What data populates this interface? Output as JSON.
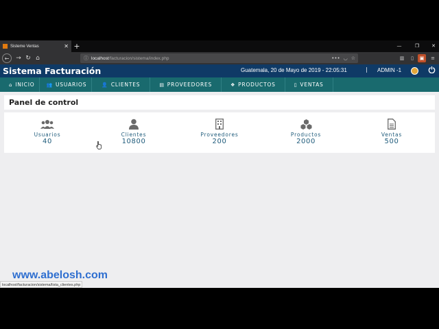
{
  "browser": {
    "tab_title": "Sisteme Ventas",
    "url_host": "localhost",
    "url_path": "/facturacion/sistema/index.php"
  },
  "header": {
    "brand": "Sistema Facturación",
    "datetime": "Guatemala, 20 de Mayo de 2019 - 22:05:31",
    "separator": "|",
    "user": "ADMIN -1"
  },
  "menu": {
    "items": [
      {
        "label": "INICIO",
        "icon": "home-icon"
      },
      {
        "label": "USUARIOS",
        "icon": "users-icon"
      },
      {
        "label": "CLIENTES",
        "icon": "user-icon"
      },
      {
        "label": "PROVEEDORES",
        "icon": "document-icon"
      },
      {
        "label": "PRODUCTOS",
        "icon": "cubes-icon"
      },
      {
        "label": "VENTAS",
        "icon": "file-icon"
      }
    ]
  },
  "panel": {
    "title": "Panel de control"
  },
  "stats": [
    {
      "label": "Usuarios",
      "value": "40",
      "icon": "users-icon"
    },
    {
      "label": "Clientes",
      "value": "10800",
      "icon": "user-icon"
    },
    {
      "label": "Proveedores",
      "value": "200",
      "icon": "building-icon"
    },
    {
      "label": "Productos",
      "value": "2000",
      "icon": "cubes-icon"
    },
    {
      "label": "Ventas",
      "value": "500",
      "icon": "file-icon"
    }
  ],
  "watermark": "www.abelosh.com",
  "status_url": "localhost/facturacion/sistema/lista_clientes.php",
  "colors": {
    "header_bg": "#0f3a66",
    "menu_bg": "#196a6e",
    "stat_text": "#1d5a7a",
    "watermark": "#2f6fd0"
  }
}
